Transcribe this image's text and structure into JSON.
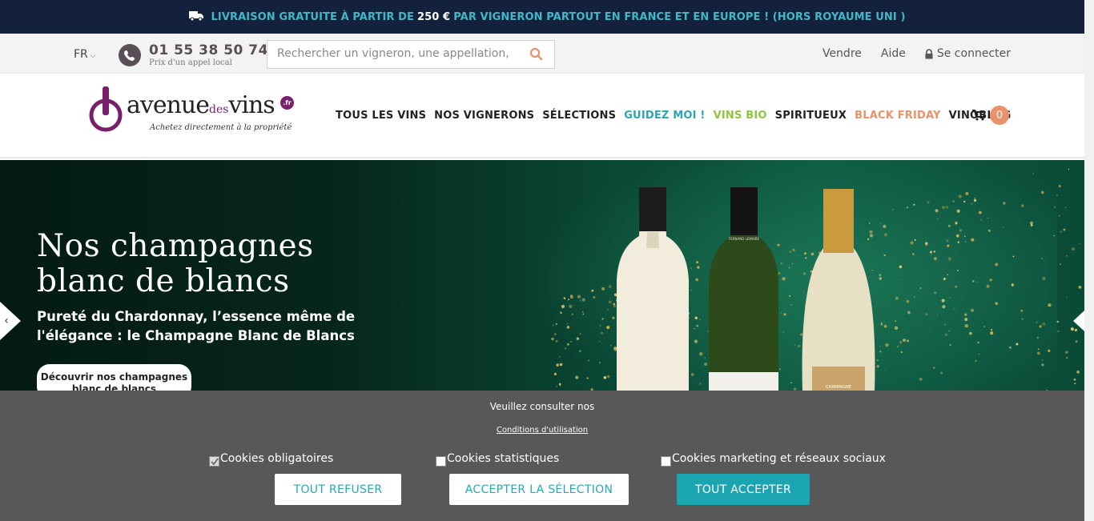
{
  "topbar": {
    "text_before": "LIVRAISON GRATUITE À PARTIR DE",
    "amount": "250 €",
    "text_after": "PAR VIGNERON PARTOUT EN FRANCE ET EN EUROPE ! (HORS ROYAUME UNI )",
    "icon": "truck-icon"
  },
  "util": {
    "lang": "FR",
    "phone": "01 55 38 50 74",
    "phone_sub": "Prix d'un appel local",
    "search_placeholder": "Rechercher un vigneron, une appellation, u",
    "sell": "Vendre",
    "help": "Aide",
    "login": "Se connecter"
  },
  "logo": {
    "avenue": "avenue",
    "des": "des",
    "vins": "vins",
    "fr": ".fr",
    "tagline": "Achetez directement à la propriété"
  },
  "nav": {
    "items": [
      "TOUS LES VINS",
      "NOS VIGNERONS",
      "SÉLECTIONS",
      "GUIDEZ MOI !",
      "VINS BIO",
      "SPIRITUEUX",
      "BLACK FRIDAY",
      "VINOBLOG"
    ]
  },
  "cart": {
    "count": "0"
  },
  "hero": {
    "title_line1": "Nos champagnes",
    "title_line2": "blanc de blancs",
    "subtitle_line1": "Pureté du Chardonnay, l’essence même de",
    "subtitle_line2": "l'élégance : le Champagne Blanc de Blancs",
    "cta_line1": "Découvrir nos champagnes",
    "cta_line2": "blanc de blancs",
    "bottle_labels": [
      "FERNAND LEMAIRE",
      "CHAMPAGNE"
    ]
  },
  "cookie": {
    "message": "Veuillez consulter nos",
    "link": "Conditions d'utilisation",
    "options": [
      {
        "label": "Cookies obligatoires",
        "checked": true
      },
      {
        "label": "Cookies statistiques",
        "checked": false
      },
      {
        "label": "Cookies marketing et réseaux sociaux",
        "checked": false
      }
    ],
    "refuse": "TOUT REFUSER",
    "accept_selection": "ACCEPTER LA SÉLECTION",
    "accept_all": "TOUT ACCEPTER"
  },
  "colors": {
    "topbar_bg": "#14213d",
    "accent_teal": "#2aa7b3",
    "bio_green": "#8cc63f",
    "black_friday": "#e8916b",
    "brand_purple": "#7a1f6b"
  }
}
